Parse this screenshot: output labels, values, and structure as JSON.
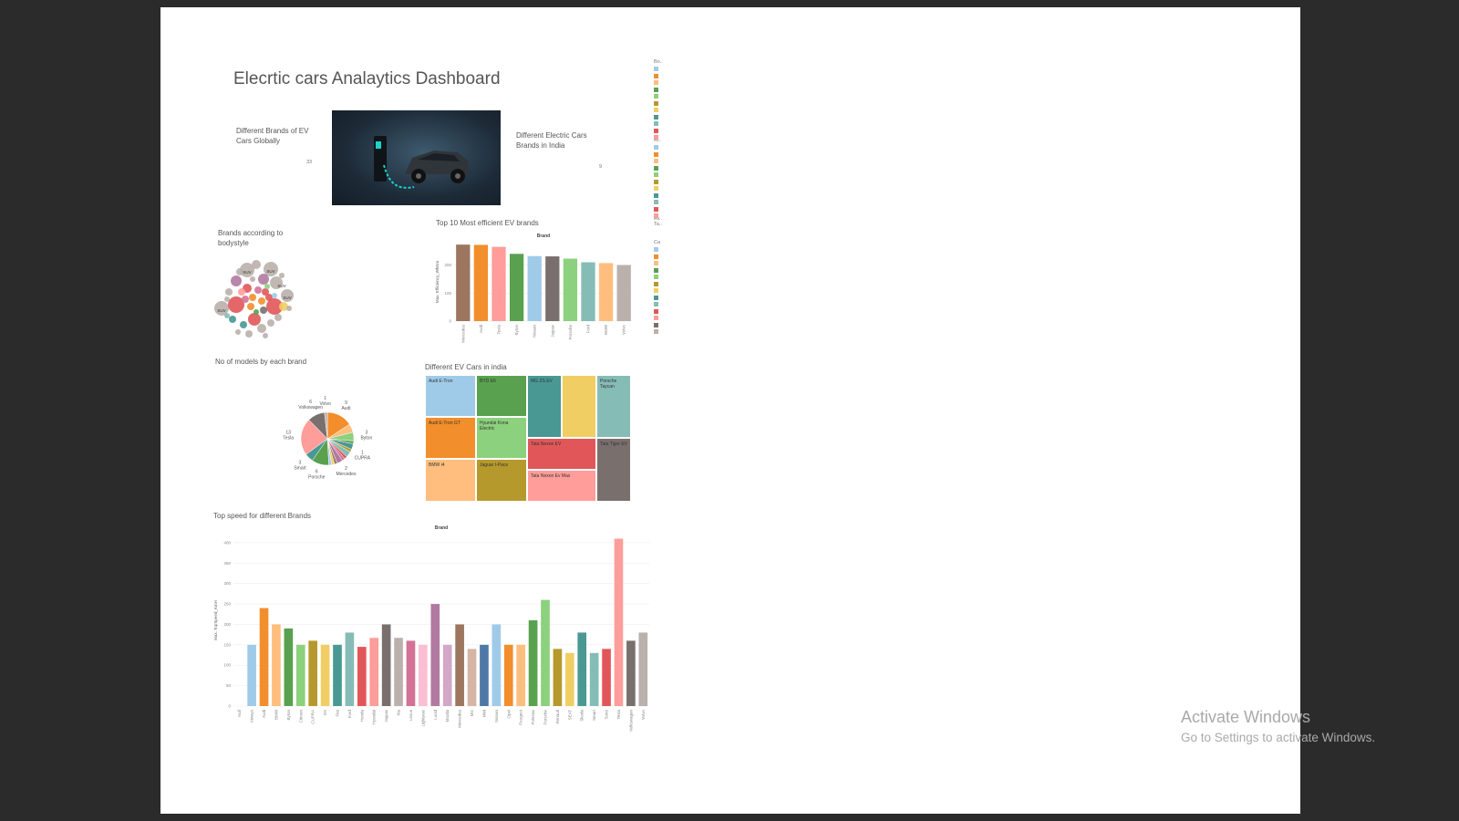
{
  "dashboard": {
    "title": "Elecrtic cars Analaytics Dashboard",
    "kpi_global_label": "Different Brands of EV Cars Globally",
    "kpi_global_value": "33",
    "kpi_india_label": "Different Electric Cars Brands in India",
    "kpi_india_value": "9",
    "bubble_title": "Brands according to bodystyle",
    "bubble_labels": [
      "SUV",
      "SUV",
      "SUV",
      "SUV",
      "SUV"
    ],
    "legend_heads": [
      "Bo..",
      "Ar..",
      "Av..",
      "Ca"
    ],
    "legend_sub": "Ta.."
  },
  "colors": {
    "palette": [
      "#a0cbe8",
      "#f28e2b",
      "#ffbe7d",
      "#59a14f",
      "#8cd17d",
      "#b6992d",
      "#f1ce63",
      "#499894",
      "#86bcb6",
      "#e15759",
      "#ff9d9a",
      "#79706e",
      "#bab0ac",
      "#d37295",
      "#fabfd2",
      "#b07aa1",
      "#d4a6c8",
      "#9d7660",
      "#d7b5a6",
      "#4e79a7"
    ]
  },
  "watermark": {
    "line1": "Activate Windows",
    "line2": "Go to Settings to activate Windows."
  },
  "chart_data": [
    {
      "type": "bar",
      "title": "Top 10 Most efficient EV brands",
      "legend_title": "Brand",
      "xlabel": "",
      "ylabel": "Max. Efficiency_WhKm",
      "categories": [
        "Mercedes",
        "Audi",
        "Tesla",
        "Byton",
        "Nissan",
        "Jaguar",
        "Porsche",
        "Ford",
        "BMW",
        "Volvo"
      ],
      "values": [
        273,
        272,
        265,
        240,
        232,
        231,
        223,
        210,
        207,
        200
      ],
      "yticks": [
        0,
        100,
        200
      ],
      "ylim": [
        0,
        280
      ],
      "colors": [
        "#9d7660",
        "#f28e2b",
        "#ff9d9a",
        "#59a14f",
        "#a0cbe8",
        "#79706e",
        "#8cd17d",
        "#86bcb6",
        "#ffbe7d",
        "#bab0ac"
      ]
    },
    {
      "type": "pie",
      "title": "No of models by each brand",
      "slices": [
        {
          "label": "Audi",
          "value": 9,
          "color": "#f28e2b"
        },
        {
          "label": "",
          "value": 3,
          "color": "#ffbe7d"
        },
        {
          "label": "Byton",
          "value": 3,
          "color": "#8cd17d"
        },
        {
          "label": "",
          "value": 1,
          "color": "#59a14f"
        },
        {
          "label": "",
          "value": 2,
          "color": "#499894"
        },
        {
          "label": "CUPRA",
          "value": 1,
          "color": "#b6992d"
        },
        {
          "label": "",
          "value": 2,
          "color": "#86bcb6"
        },
        {
          "label": "",
          "value": 1,
          "color": "#e15759"
        },
        {
          "label": "",
          "value": 1,
          "color": "#d37295"
        },
        {
          "label": "Mercedes",
          "value": 2,
          "color": "#b07aa1"
        },
        {
          "label": "",
          "value": 1,
          "color": "#9d7660"
        },
        {
          "label": "",
          "value": 1,
          "color": "#f1ce63"
        },
        {
          "label": "",
          "value": 1,
          "color": "#a0cbe8"
        },
        {
          "label": "Porsche",
          "value": 6,
          "color": "#59a14f"
        },
        {
          "label": "Smart",
          "value": 3,
          "color": "#499894"
        },
        {
          "label": "Tesla",
          "value": 13,
          "color": "#ff9d9a"
        },
        {
          "label": "Volkswagen",
          "value": 6,
          "color": "#79706e"
        },
        {
          "label": "Volvo",
          "value": 1,
          "color": "#bab0ac"
        }
      ],
      "printed_labels": [
        {
          "text": "9",
          "sub": "Audi"
        },
        {
          "text": "3",
          "sub": "Byton"
        },
        {
          "text": "1",
          "sub": "CUPRA"
        },
        {
          "text": "2",
          "sub": "Mercedes"
        },
        {
          "text": "6",
          "sub": "Porsche"
        },
        {
          "text": "3",
          "sub": "Smart"
        },
        {
          "text": "13",
          "sub": "Tesla"
        },
        {
          "text": "6",
          "sub": "Volkswagen"
        },
        {
          "text": "1",
          "sub": "Volvo"
        }
      ]
    },
    {
      "type": "treemap",
      "title": "Different EV Cars in india",
      "cells": [
        {
          "label": "Audi E-Tron",
          "color": "#a0cbe8"
        },
        {
          "label": "Audi E-Tron GT",
          "color": "#f28e2b"
        },
        {
          "label": "BMW i4",
          "color": "#ffbe7d"
        },
        {
          "label": "BYD E6",
          "color": "#59a14f"
        },
        {
          "label": "Hyundai Kona Electric",
          "color": "#8cd17d"
        },
        {
          "label": "Jaguar I-Pace",
          "color": "#b6992d"
        },
        {
          "label": "MG ZS EV",
          "color": "#499894"
        },
        {
          "label": "",
          "color": "#f1ce63"
        },
        {
          "label": "Porsche Taycan",
          "color": "#86bcb6"
        },
        {
          "label": "Tata Nexon EV",
          "color": "#e15759"
        },
        {
          "label": "Tata Nexon Ev Max",
          "color": "#ff9d9a"
        },
        {
          "label": "Tata Tigor EV",
          "color": "#79706e"
        }
      ]
    },
    {
      "type": "bar",
      "title": "Top speed for different Brands",
      "legend_title": "Brand",
      "xlabel": "",
      "ylabel": "Max. TopSpeed_KmH",
      "categories": [
        "Null",
        "Aiways",
        "Audi",
        "BMW",
        "Byton",
        "Citroen",
        "CUPRA",
        "DS",
        "Fiat",
        "Ford",
        "Honda",
        "Hyundai",
        "Jaguar",
        "Kia",
        "Lexus",
        "Lightyear",
        "Lucid",
        "Mazda",
        "Mercedes",
        "MG",
        "Mini",
        "Nissan",
        "Opel",
        "Peugeot",
        "Polestar",
        "Porsche",
        "Renault",
        "SEAT",
        "Skoda",
        "Smart",
        "Sono",
        "Tesla",
        "Volkswagen",
        "Volvo"
      ],
      "values": [
        null,
        150,
        240,
        200,
        190,
        150,
        160,
        150,
        150,
        180,
        145,
        167,
        200,
        167,
        160,
        150,
        250,
        150,
        200,
        140,
        150,
        200,
        150,
        150,
        210,
        260,
        140,
        130,
        180,
        130,
        140,
        410,
        160,
        180
      ],
      "yticks": [
        0,
        50,
        100,
        150,
        200,
        250,
        300,
        350,
        400
      ],
      "ylim": [
        0,
        420
      ],
      "colors": [
        "#ffffff",
        "#a0cbe8",
        "#f28e2b",
        "#ffbe7d",
        "#59a14f",
        "#8cd17d",
        "#b6992d",
        "#f1ce63",
        "#499894",
        "#86bcb6",
        "#e15759",
        "#ff9d9a",
        "#79706e",
        "#bab0ac",
        "#d37295",
        "#fabfd2",
        "#b07aa1",
        "#d4a6c8",
        "#9d7660",
        "#d7b5a6",
        "#4e79a7",
        "#a0cbe8",
        "#f28e2b",
        "#ffbe7d",
        "#59a14f",
        "#8cd17d",
        "#b6992d",
        "#f1ce63",
        "#499894",
        "#86bcb6",
        "#e15759",
        "#ff9d9a",
        "#79706e",
        "#bab0ac"
      ]
    }
  ]
}
